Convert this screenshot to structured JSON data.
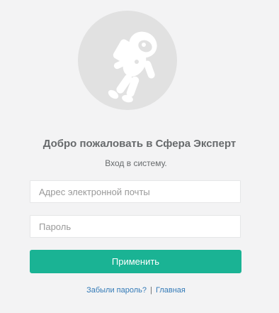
{
  "login": {
    "avatar_icon": "astronaut-icon",
    "title": "Добро пожаловать в Сфера Эксперт",
    "subtitle": "Вход в систему.",
    "email_placeholder": "Адрес электронной почты",
    "email_value": "",
    "password_placeholder": "Пароль",
    "password_value": "",
    "submit_label": "Применить",
    "forgot_link": "Забыли пароль?",
    "separator": "|",
    "home_link": "Главная"
  },
  "colors": {
    "background": "#f3f3f4",
    "accent": "#1ab394",
    "link": "#337ab7",
    "avatar_bg": "#e1e1e1"
  }
}
